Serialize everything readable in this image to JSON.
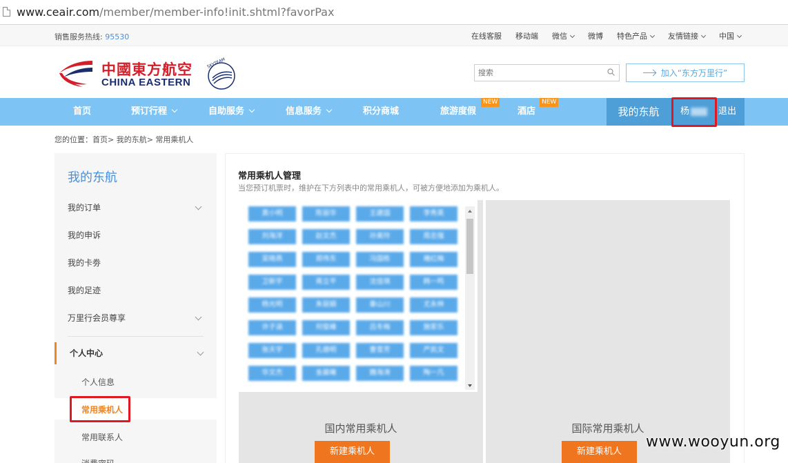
{
  "browser": {
    "url_host": "www.ceair.com",
    "url_path": "/member/member-info!init.shtml?favorPax"
  },
  "topbar": {
    "hotline_label": "销售服务热线:",
    "hotline_number": "95530",
    "links": [
      "在线客服",
      "移动端",
      "微信",
      "微博",
      "特色产品",
      "友情链接",
      "中国"
    ]
  },
  "header": {
    "logo_cn": "中國東方航空",
    "logo_en": "CHINA EASTERN",
    "skyteam": "SKYTEAM",
    "search_placeholder": "搜索",
    "join_label": "加入“东方万里行”"
  },
  "nav": {
    "items": [
      "首页",
      "预订行程",
      "自助服务",
      "信息服务",
      "积分商城",
      "旅游度假",
      "酒店"
    ],
    "new_badge": "NEW",
    "my_label": "我的东航",
    "user_name": "杨",
    "logout": "退出"
  },
  "breadcrumb": "您的位置：首页> 我的东航> 常用乘机人",
  "sidebar": {
    "title": "我的东航",
    "items": [
      "我的订单",
      "我的申诉",
      "我的卡劵",
      "我的足迹",
      "万里行会员尊享",
      "个人中心"
    ],
    "sub_items": [
      "个人信息",
      "常用乘机人",
      "常用联系人",
      "消费密码"
    ]
  },
  "main": {
    "heading": "常用乘机人管理",
    "description": "当您预订机票时，维护在下方列表中的常用乘机人，可被方便地添加为乘机人。",
    "domestic_label": "国内常用乘机人",
    "international_label": "国际常用乘机人",
    "new_button": "新建乘机人",
    "passengers": [
      "黄小明",
      "陈丽华",
      "王建国",
      "李秀英",
      "刘海洋",
      "赵文杰",
      "孙美玲",
      "周志强",
      "吴晓燕",
      "郑伟东",
      "冯国栋",
      "褚红梅",
      "卫新宇",
      "蒋立平",
      "沈佳琪",
      "韩一鸣",
      "杨光明",
      "朱丽娟",
      "秦山川",
      "尤永林",
      "许子涵",
      "何俊峰",
      "吕冬梅",
      "施家乐",
      "张天宇",
      "孔德明",
      "曹雪芳",
      "严凯文",
      "华文杰",
      "金晨曦",
      "魏海涛",
      "陶一凡"
    ]
  },
  "watermark": "www.wooyun.org",
  "colors": {
    "nav_bg": "#7dc4f4",
    "nav_active": "#4e9fd8",
    "accent_orange": "#f0751f",
    "brand_red": "#d31f29",
    "brand_blue": "#1a2e6e",
    "highlight_box": "#e0181f"
  }
}
